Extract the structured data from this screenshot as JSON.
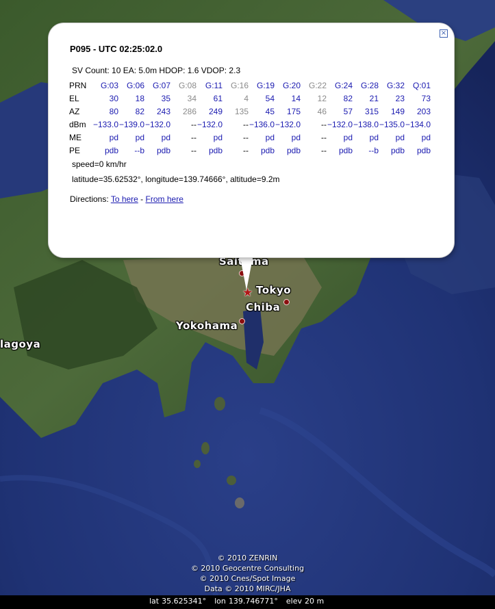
{
  "map": {
    "labels": {
      "saitama": "Saitama",
      "tokyo": "Tokyo",
      "chiba": "Chiba",
      "yokohama": "Yokohama",
      "nagoya": "lagoya"
    },
    "copyright": [
      "© 2010 ZENRIN",
      "© 2010 Geocentre Consulting",
      "© 2010 Cnes/Spot Image",
      "Data © 2010 MIRC/JHA"
    ],
    "status": {
      "lat_label": "lat",
      "lat_value": "35.625341°",
      "lon_label": "lon",
      "lon_value": "139.746771°",
      "elev_label": "elev",
      "elev_value": "20 m"
    }
  },
  "balloon": {
    "close_glyph": "×",
    "title": "P095 - UTC 02:25:02.0",
    "sv_count": "SV Count: 10 EA: 5.0m HDOP: 1.6 VDOP: 2.3",
    "row_labels": [
      "PRN",
      "EL",
      "AZ",
      "dBm",
      "ME",
      "PE"
    ],
    "satellites": [
      {
        "prn": "G:03",
        "el": "30",
        "az": "80",
        "dbm": "−133.0",
        "me": "pd",
        "pe": "pdb",
        "used": true
      },
      {
        "prn": "G:06",
        "el": "18",
        "az": "82",
        "dbm": "−139.0",
        "me": "pd",
        "pe": "--b",
        "used": true
      },
      {
        "prn": "G:07",
        "el": "35",
        "az": "243",
        "dbm": "−132.0",
        "me": "pd",
        "pe": "pdb",
        "used": true
      },
      {
        "prn": "G:08",
        "el": "34",
        "az": "286",
        "dbm": "--",
        "me": "--",
        "pe": "--",
        "used": false
      },
      {
        "prn": "G:11",
        "el": "61",
        "az": "249",
        "dbm": "−132.0",
        "me": "pd",
        "pe": "pdb",
        "used": true
      },
      {
        "prn": "G:16",
        "el": "4",
        "az": "135",
        "dbm": "--",
        "me": "--",
        "pe": "--",
        "used": false
      },
      {
        "prn": "G:19",
        "el": "54",
        "az": "45",
        "dbm": "−136.0",
        "me": "pd",
        "pe": "pdb",
        "used": true
      },
      {
        "prn": "G:20",
        "el": "14",
        "az": "175",
        "dbm": "−132.0",
        "me": "pd",
        "pe": "pdb",
        "used": true
      },
      {
        "prn": "G:22",
        "el": "12",
        "az": "46",
        "dbm": "--",
        "me": "--",
        "pe": "--",
        "used": false
      },
      {
        "prn": "G:24",
        "el": "82",
        "az": "57",
        "dbm": "−132.0",
        "me": "pd",
        "pe": "pdb",
        "used": true
      },
      {
        "prn": "G:28",
        "el": "21",
        "az": "315",
        "dbm": "−138.0",
        "me": "pd",
        "pe": "--b",
        "used": true
      },
      {
        "prn": "G:32",
        "el": "23",
        "az": "149",
        "dbm": "−135.0",
        "me": "pd",
        "pe": "pdb",
        "used": true
      },
      {
        "prn": "Q:01",
        "el": "73",
        "az": "203",
        "dbm": "−134.0",
        "me": "pd",
        "pe": "pdb",
        "used": true
      }
    ],
    "speed": "speed=0 km/hr",
    "coords": "latitude=35.62532°, longitude=139.74666°, altitude=9.2m",
    "directions_label": "Directions:",
    "to_here": "To here",
    "separator": " - ",
    "from_here": "From here"
  },
  "colors": {
    "link": "#1a1ab0",
    "unused_satellite": "#8a8a8a",
    "marker": "#8a0f0f",
    "ocean": "#1e2f6a"
  }
}
